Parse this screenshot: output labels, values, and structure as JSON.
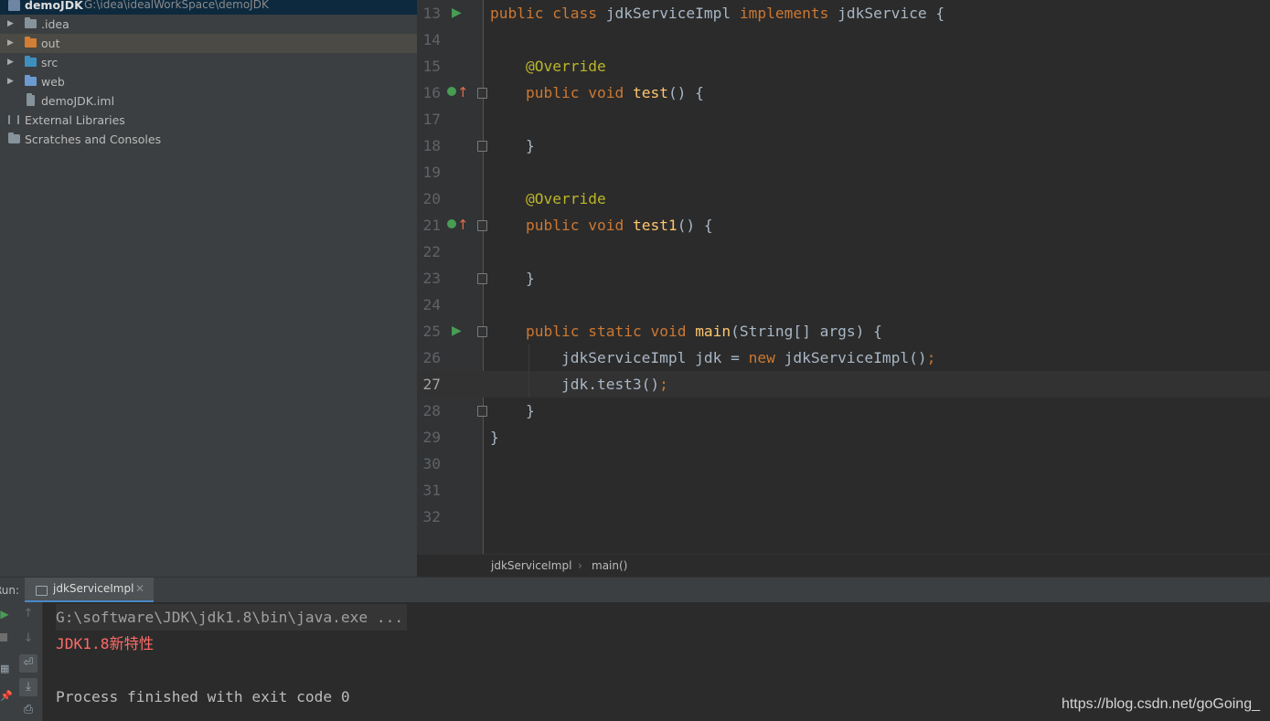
{
  "project": {
    "root": {
      "name": "demoJDK",
      "path": "G:\\idea\\idealWorkSpace\\demoJDK"
    },
    "items": [
      {
        "label": ".idea",
        "icon": "folder-icon",
        "color": "#87939a",
        "expandable": true
      },
      {
        "label": "out",
        "icon": "folder-icon",
        "color": "#d27e35",
        "expandable": true,
        "selected": true
      },
      {
        "label": "src",
        "icon": "source-folder-icon",
        "color": "#3d8fc0",
        "expandable": true
      },
      {
        "label": "web",
        "icon": "web-folder-icon",
        "color": "#6b9bd1",
        "expandable": true
      },
      {
        "label": "demoJDK.iml",
        "icon": "module-file-icon",
        "color": "#87939a",
        "expandable": false
      },
      {
        "label": "External Libraries",
        "icon": "libraries-icon",
        "color": "#87939a",
        "expandable": false
      },
      {
        "label": "Scratches and Consoles",
        "icon": "scratches-icon",
        "color": "#87939a",
        "expandable": false
      }
    ]
  },
  "editor": {
    "current_line": 27,
    "lines": [
      {
        "n": "13",
        "code": "public class jdkServiceImpl implements jdkService {",
        "marker": "run"
      },
      {
        "n": "14",
        "code": ""
      },
      {
        "n": "15",
        "code": "    @Override"
      },
      {
        "n": "16",
        "code": "    public void test() {",
        "marker": "implements",
        "fold": true
      },
      {
        "n": "17",
        "code": ""
      },
      {
        "n": "18",
        "code": "    }",
        "fold": true
      },
      {
        "n": "19",
        "code": ""
      },
      {
        "n": "20",
        "code": "    @Override"
      },
      {
        "n": "21",
        "code": "    public void test1() {",
        "marker": "implements",
        "fold": true
      },
      {
        "n": "22",
        "code": ""
      },
      {
        "n": "23",
        "code": "    }",
        "fold": true
      },
      {
        "n": "24",
        "code": ""
      },
      {
        "n": "25",
        "code": "    public static void main(String[] args) {",
        "marker": "run",
        "fold": true
      },
      {
        "n": "26",
        "code": "        jdkServiceImpl jdk = new jdkServiceImpl();"
      },
      {
        "n": "27",
        "code": "        jdk.test3();"
      },
      {
        "n": "28",
        "code": "    }",
        "fold": true
      },
      {
        "n": "29",
        "code": "}"
      },
      {
        "n": "30",
        "code": ""
      },
      {
        "n": "31",
        "code": ""
      },
      {
        "n": "32",
        "code": ""
      }
    ],
    "breadcrumbs": [
      "jdkServiceImpl",
      "main()"
    ]
  },
  "run_panel": {
    "label": "Run:",
    "tab_label": "jdkServiceImpl",
    "console": [
      {
        "text": "G:\\software\\JDK\\jdk1.8\\bin\\java.exe ...",
        "kind": "cmd"
      },
      {
        "text": "JDK1.8新特性",
        "kind": "out"
      },
      {
        "text": "",
        "kind": "blank"
      },
      {
        "text": "Process finished with exit code 0",
        "kind": "fin"
      }
    ]
  },
  "watermark": "https://blog.csdn.net/goGoing_",
  "colors": {
    "keyword": "#cc7832",
    "function": "#ffc66d",
    "annotation": "#bbb529",
    "plain": "#a9b7c6",
    "error_output": "#ff6b68",
    "run_green": "#499c54",
    "accent_blue": "#4a88c7"
  }
}
